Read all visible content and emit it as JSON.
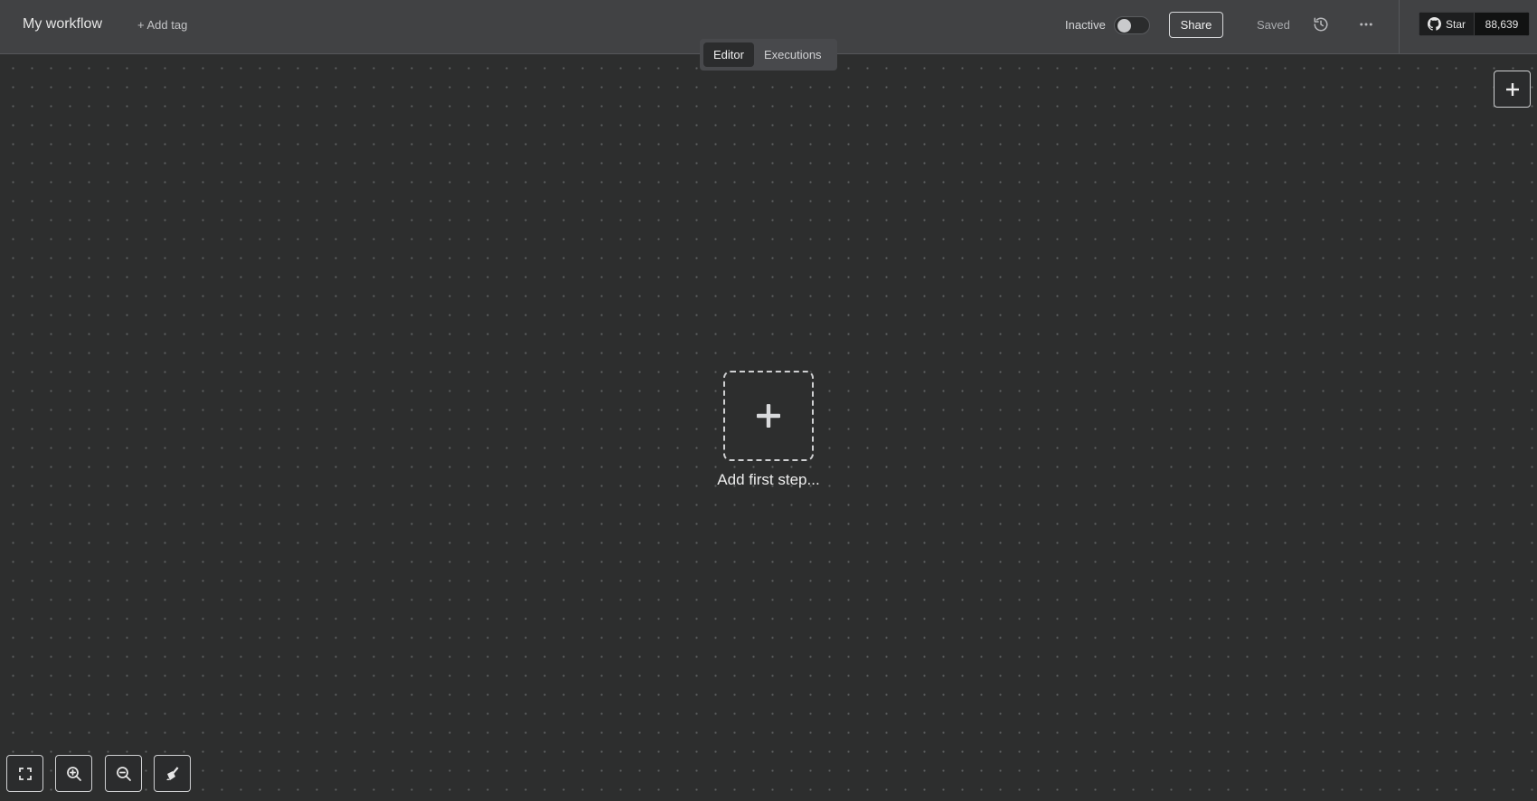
{
  "header": {
    "workflow_name": "My workflow",
    "add_tag_label": "+ Add tag",
    "active_label": "Inactive",
    "active_state": false,
    "share_label": "Share",
    "save_status": "Saved",
    "history_icon": "history-icon",
    "more_icon": "more-horizontal-icon",
    "github": {
      "star_label": "Star",
      "star_count": "88,639"
    }
  },
  "tabs": [
    {
      "label": "Editor",
      "active": true
    },
    {
      "label": "Executions",
      "active": false
    }
  ],
  "canvas": {
    "add_node_icon": "plus-icon",
    "first_step_label": "Add first step..."
  },
  "controls": [
    {
      "name": "fit-view",
      "icon": "fullscreen-icon"
    },
    {
      "name": "zoom-in",
      "icon": "zoom-in-icon"
    },
    {
      "name": "zoom-out",
      "icon": "zoom-out-icon"
    },
    {
      "name": "tidy-up",
      "icon": "broom-icon"
    }
  ],
  "colors": {
    "header_bg": "#414244",
    "canvas_bg": "#2d2e2e",
    "grid_dot": "#5f6163"
  }
}
